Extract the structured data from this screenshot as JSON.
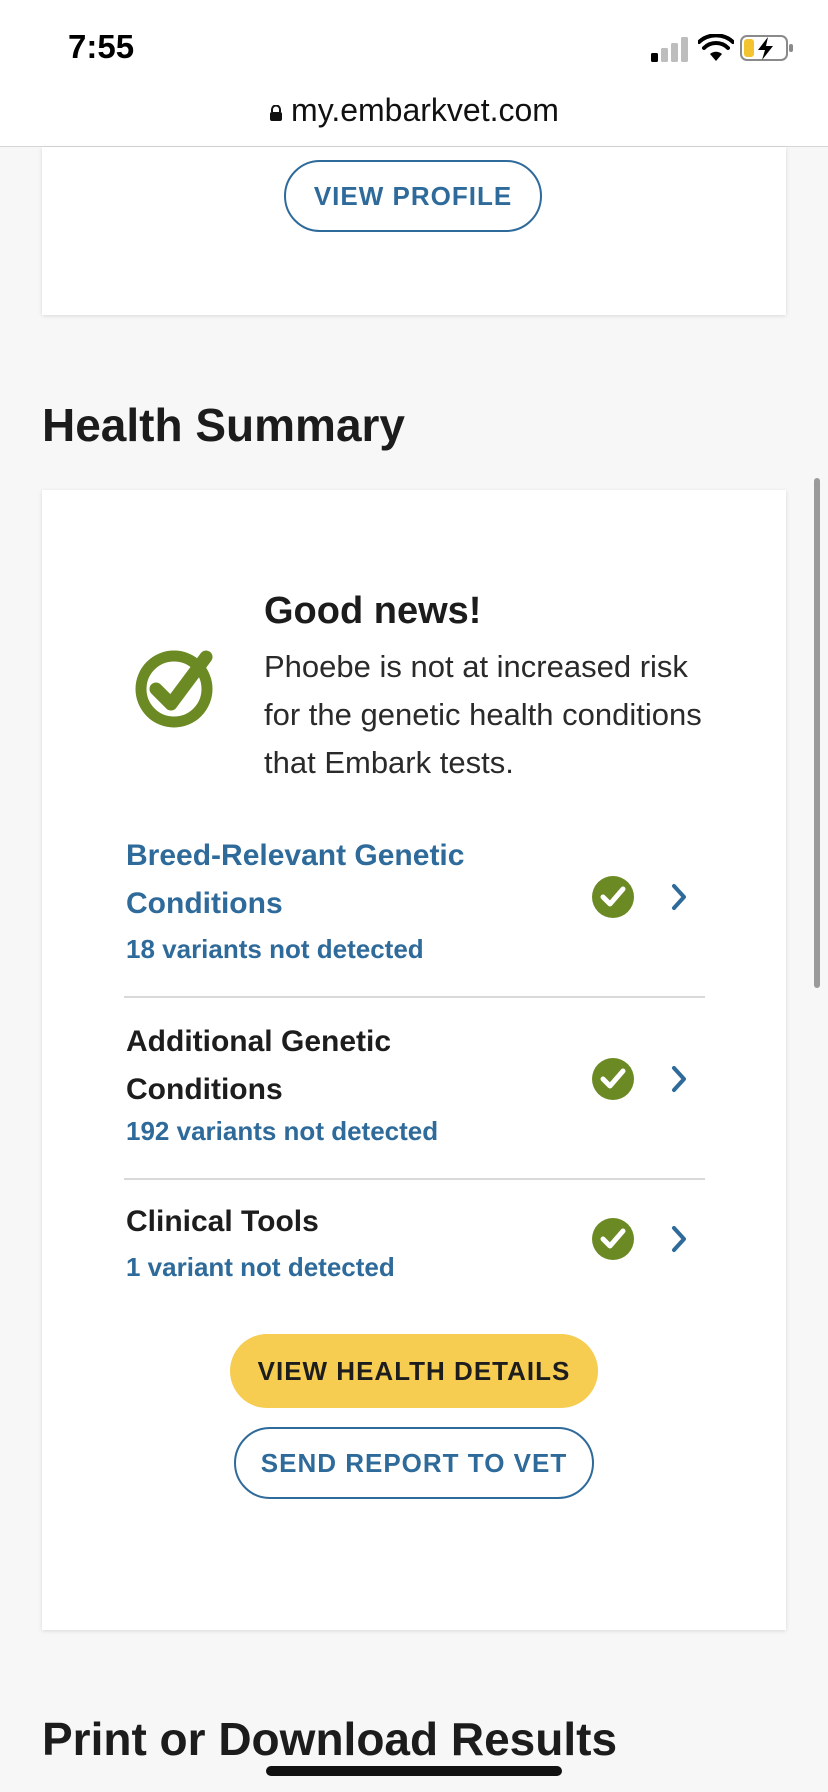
{
  "status_bar": {
    "time": "7:55"
  },
  "browser": {
    "url": "my.embarkvet.com"
  },
  "profile_card": {
    "view_profile_label": "VIEW PROFILE"
  },
  "health_summary": {
    "section_title": "Health Summary",
    "headline": "Good news!",
    "message": "Phoebe is not at increased risk for the genetic health conditions that Embark tests.",
    "conditions": [
      {
        "title": "Breed-Relevant Genetic Conditions",
        "subtitle": "18 variants not detected"
      },
      {
        "title": "Additional Genetic Conditions",
        "subtitle": "192 variants not detected"
      },
      {
        "title": "Clinical Tools",
        "subtitle": "1 variant not detected"
      }
    ],
    "view_details_label": "VIEW HEALTH DETAILS",
    "send_vet_label": "SEND REPORT TO VET"
  },
  "print_section": {
    "section_title": "Print or Download Results"
  },
  "colors": {
    "brand_blue": "#2e6a9a",
    "success_green": "#6b8a23",
    "cta_yellow": "#f6cc51"
  },
  "icons": [
    "signal-icon",
    "wifi-icon",
    "battery-charging-icon",
    "lock-icon",
    "check-circle-icon",
    "chevron-right-icon"
  ]
}
